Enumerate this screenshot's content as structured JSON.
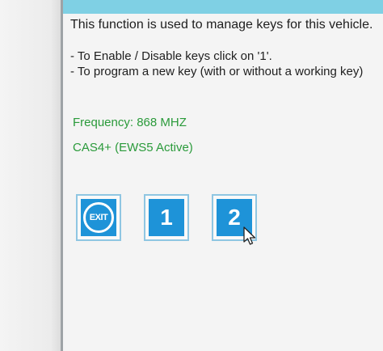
{
  "panel": {
    "description": "This function is used to manage keys for this vehicle.",
    "instructions": [
      "- To Enable / Disable keys click on '1'.",
      "- To program a new key (with or without a working key)"
    ]
  },
  "vehicle_info": {
    "frequency": "Frequency: 868 MHZ",
    "module": "CAS4+ (EWS5 Active)"
  },
  "buttons": {
    "exit": "EXIT",
    "one": "1",
    "two": "2"
  },
  "icons": {
    "exit": "exit-icon",
    "cursor": "mouse-pointer-icon"
  },
  "colors": {
    "accent_blue": "#1e93d8",
    "info_green": "#2a9a3a",
    "top_band": "#7fd0e4"
  }
}
